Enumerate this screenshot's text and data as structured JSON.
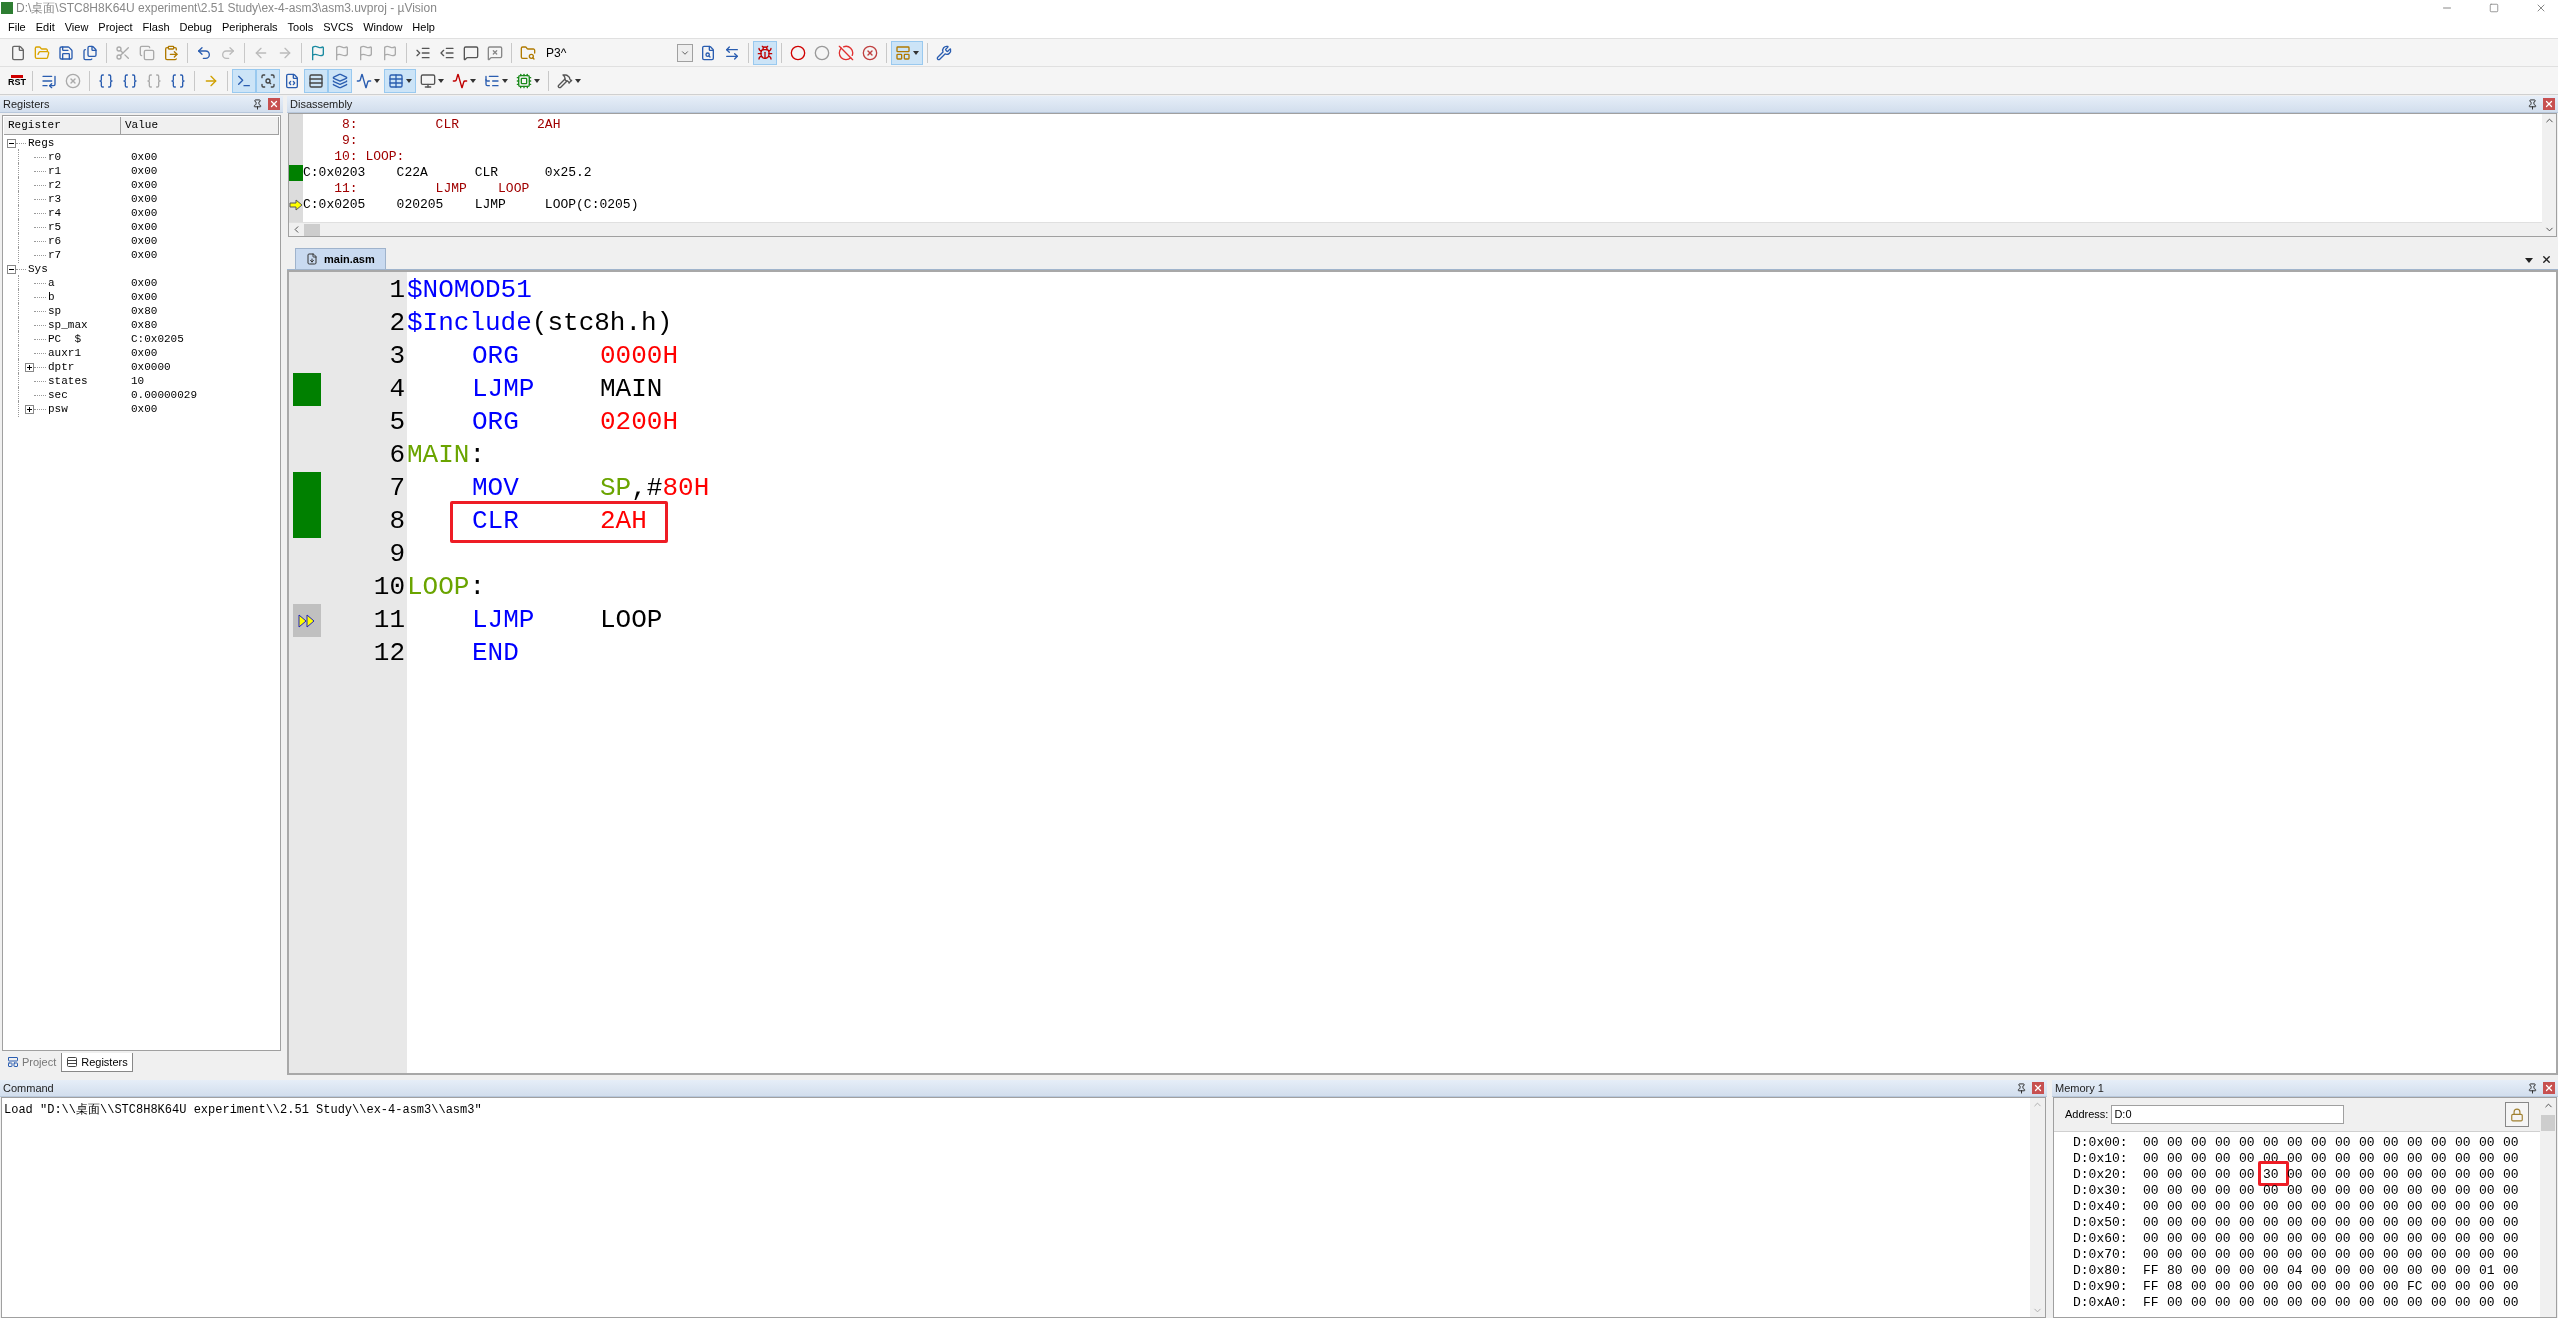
{
  "window": {
    "title": "D:\\桌面\\STC8H8K64U experiment\\2.51 Study\\ex-4-asm3\\asm3.uvproj - µVision"
  },
  "menu": [
    "File",
    "Edit",
    "View",
    "Project",
    "Flash",
    "Debug",
    "Peripherals",
    "Tools",
    "SVCS",
    "Window",
    "Help"
  ],
  "toolbar_1": {
    "items": [
      {
        "kind": "button",
        "pressed": false,
        "dropdown": false
      },
      {
        "kind": "button",
        "pressed": false,
        "dropdown": false
      },
      {
        "kind": "button",
        "pressed": false,
        "dropdown": false
      },
      {
        "kind": "button",
        "pressed": false,
        "dropdown": false
      },
      {
        "kind": "separator"
      },
      {
        "kind": "button",
        "pressed": false,
        "dropdown": false
      },
      {
        "kind": "button",
        "pressed": false,
        "dropdown": false
      },
      {
        "kind": "button",
        "pressed": false,
        "dropdown": false
      },
      {
        "kind": "separator"
      },
      {
        "kind": "button",
        "pressed": false,
        "dropdown": false
      },
      {
        "kind": "button",
        "pressed": false,
        "dropdown": false
      },
      {
        "kind": "separator"
      },
      {
        "kind": "button",
        "pressed": false,
        "dropdown": false
      },
      {
        "kind": "button",
        "pressed": false,
        "dropdown": false
      },
      {
        "kind": "separator"
      },
      {
        "kind": "button",
        "pressed": false,
        "dropdown": false
      },
      {
        "kind": "button",
        "pressed": false,
        "dropdown": false
      },
      {
        "kind": "button",
        "pressed": false,
        "dropdown": false
      },
      {
        "kind": "button",
        "pressed": false,
        "dropdown": false
      },
      {
        "kind": "separator"
      },
      {
        "kind": "button",
        "pressed": false,
        "dropdown": false
      },
      {
        "kind": "button",
        "pressed": false,
        "dropdown": false
      },
      {
        "kind": "button",
        "pressed": false,
        "dropdown": false
      },
      {
        "kind": "button",
        "pressed": false,
        "dropdown": false
      },
      {
        "kind": "separator"
      },
      {
        "kind": "button",
        "pressed": false,
        "dropdown": false
      },
      {
        "kind": "combo",
        "value": "P3^"
      },
      {
        "kind": "button",
        "pressed": false,
        "dropdown": false
      },
      {
        "kind": "button",
        "pressed": false,
        "dropdown": false
      },
      {
        "kind": "separator"
      },
      {
        "kind": "button",
        "pressed": true,
        "dropdown": false
      },
      {
        "kind": "separator"
      },
      {
        "kind": "button",
        "pressed": false,
        "dropdown": false
      },
      {
        "kind": "button",
        "pressed": false,
        "dropdown": false
      },
      {
        "kind": "button",
        "pressed": false,
        "dropdown": false
      },
      {
        "kind": "button",
        "pressed": false,
        "dropdown": false
      },
      {
        "kind": "separator"
      },
      {
        "kind": "button",
        "pressed": true,
        "dropdown": true
      },
      {
        "kind": "separator"
      },
      {
        "kind": "button",
        "pressed": false,
        "dropdown": false
      }
    ]
  },
  "toolbar_2": {
    "items": [
      {
        "kind": "text_button",
        "label": "RST"
      },
      {
        "kind": "separator"
      },
      {
        "kind": "button",
        "pressed": false,
        "dropdown": false
      },
      {
        "kind": "button",
        "pressed": false,
        "dropdown": false
      },
      {
        "kind": "separator"
      },
      {
        "kind": "button",
        "pressed": false,
        "dropdown": false
      },
      {
        "kind": "button",
        "pressed": false,
        "dropdown": false
      },
      {
        "kind": "button",
        "pressed": false,
        "dropdown": false
      },
      {
        "kind": "button",
        "pressed": false,
        "dropdown": false
      },
      {
        "kind": "separator"
      },
      {
        "kind": "button",
        "pressed": false,
        "dropdown": false
      },
      {
        "kind": "separator"
      },
      {
        "kind": "button",
        "pressed": true,
        "dropdown": false
      },
      {
        "kind": "button",
        "pressed": true,
        "dropdown": false
      },
      {
        "kind": "button",
        "pressed": false,
        "dropdown": false
      },
      {
        "kind": "button",
        "pressed": true,
        "dropdown": false
      },
      {
        "kind": "button",
        "pressed": true,
        "dropdown": false
      },
      {
        "kind": "button",
        "pressed": false,
        "dropdown": true
      },
      {
        "kind": "button",
        "pressed": true,
        "dropdown": true
      },
      {
        "kind": "button",
        "pressed": false,
        "dropdown": true
      },
      {
        "kind": "button",
        "pressed": false,
        "dropdown": true
      },
      {
        "kind": "button",
        "pressed": false,
        "dropdown": true
      },
      {
        "kind": "button",
        "pressed": false,
        "dropdown": true
      },
      {
        "kind": "separator"
      },
      {
        "kind": "button",
        "pressed": false,
        "dropdown": true
      }
    ]
  },
  "registers": {
    "title": "Registers",
    "columns": [
      "Register",
      "Value"
    ],
    "groups": [
      {
        "name": "Regs",
        "expanded": true,
        "children": [
          {
            "kind": "leaf",
            "name": "r0",
            "value": "0x00"
          },
          {
            "kind": "leaf",
            "name": "r1",
            "value": "0x00"
          },
          {
            "kind": "leaf",
            "name": "r2",
            "value": "0x00"
          },
          {
            "kind": "leaf",
            "name": "r3",
            "value": "0x00"
          },
          {
            "kind": "leaf",
            "name": "r4",
            "value": "0x00"
          },
          {
            "kind": "leaf",
            "name": "r5",
            "value": "0x00"
          },
          {
            "kind": "leaf",
            "name": "r6",
            "value": "0x00"
          },
          {
            "kind": "leaf",
            "name": "r7",
            "value": "0x00"
          }
        ]
      },
      {
        "name": "Sys",
        "expanded": true,
        "children": [
          {
            "kind": "leaf",
            "name": "a",
            "value": "0x00"
          },
          {
            "kind": "leaf",
            "name": "b",
            "value": "0x00"
          },
          {
            "kind": "leaf",
            "name": "sp",
            "value": "0x80"
          },
          {
            "kind": "leaf",
            "name": "sp_max",
            "value": "0x80"
          },
          {
            "kind": "leaf",
            "name": "PC  $",
            "value": "C:0x0205"
          },
          {
            "kind": "leaf",
            "name": "auxr1",
            "value": "0x00"
          },
          {
            "kind": "node",
            "expanded": false,
            "name": "dptr",
            "value": "0x0000"
          },
          {
            "kind": "leaf",
            "name": "states",
            "value": "10"
          },
          {
            "kind": "leaf",
            "name": "sec",
            "value": "0.00000029"
          },
          {
            "kind": "node",
            "expanded": false,
            "name": "psw",
            "value": "0x00"
          }
        ]
      }
    ],
    "tabs": [
      {
        "label": "Project",
        "selected": false
      },
      {
        "label": "Registers",
        "selected": true
      }
    ]
  },
  "disassembly": {
    "title": "Disassembly",
    "lines": [
      {
        "kind": "source",
        "executed": false,
        "current": false,
        "text": "     8:          CLR          2AH"
      },
      {
        "kind": "source",
        "executed": false,
        "current": false,
        "text": "     9:"
      },
      {
        "kind": "source",
        "executed": false,
        "current": false,
        "text": "    10: LOOP:"
      },
      {
        "kind": "asm",
        "executed": true,
        "current": false,
        "text": "C:0x0203    C22A      CLR      0x25.2"
      },
      {
        "kind": "source",
        "executed": false,
        "current": false,
        "text": "    11:          LJMP    LOOP"
      },
      {
        "kind": "asm",
        "executed": false,
        "current": true,
        "text": "C:0x0205    020205    LJMP     LOOP(C:0205)"
      }
    ]
  },
  "editor": {
    "tab": {
      "label": "main.asm",
      "selected": true
    },
    "lines": [
      {
        "number": "1",
        "kind": "directive",
        "executed": false,
        "current": false,
        "highlighted": false,
        "tokens": [
          {
            "kind": "keyword",
            "text": "$NOMOD51"
          }
        ]
      },
      {
        "number": "2",
        "kind": "directive",
        "executed": false,
        "current": false,
        "highlighted": false,
        "tokens": [
          {
            "kind": "keyword",
            "text": "$Include"
          },
          {
            "kind": "plain",
            "text": "(stc8h.h)"
          }
        ]
      },
      {
        "number": "3",
        "kind": "instruction",
        "executed": false,
        "current": false,
        "highlighted": false,
        "mnemonic": "ORG",
        "tokens": [
          {
            "kind": "number",
            "text": "0000H"
          }
        ]
      },
      {
        "number": "4",
        "kind": "instruction",
        "executed": true,
        "current": false,
        "highlighted": false,
        "mnemonic": "LJMP",
        "tokens": [
          {
            "kind": "plain",
            "text": "MAIN"
          }
        ]
      },
      {
        "number": "5",
        "kind": "instruction",
        "executed": false,
        "current": false,
        "highlighted": false,
        "mnemonic": "ORG",
        "tokens": [
          {
            "kind": "number",
            "text": "0200H"
          }
        ]
      },
      {
        "number": "6",
        "kind": "directive",
        "executed": false,
        "current": false,
        "highlighted": false,
        "tokens": [
          {
            "kind": "label",
            "text": "MAIN"
          },
          {
            "kind": "plain",
            "text": ":"
          }
        ]
      },
      {
        "number": "7",
        "kind": "instruction",
        "executed": true,
        "current": false,
        "highlighted": false,
        "mnemonic": "MOV",
        "tokens": [
          {
            "kind": "label",
            "text": "SP"
          },
          {
            "kind": "plain",
            "text": ",#"
          },
          {
            "kind": "number",
            "text": "80H"
          }
        ]
      },
      {
        "number": "8",
        "kind": "instruction",
        "executed": true,
        "current": false,
        "highlighted": true,
        "mnemonic": "CLR",
        "tokens": [
          {
            "kind": "number",
            "text": "2AH"
          }
        ]
      },
      {
        "number": "9",
        "kind": "blank",
        "executed": false,
        "current": false,
        "highlighted": false
      },
      {
        "number": "10",
        "kind": "directive",
        "executed": false,
        "current": false,
        "highlighted": false,
        "tokens": [
          {
            "kind": "label",
            "text": "LOOP"
          },
          {
            "kind": "plain",
            "text": ":"
          }
        ]
      },
      {
        "number": "11",
        "kind": "instruction",
        "executed": false,
        "current": true,
        "highlighted": false,
        "mnemonic": "LJMP",
        "tokens": [
          {
            "kind": "plain",
            "text": "LOOP"
          }
        ]
      },
      {
        "number": "12",
        "kind": "instruction",
        "executed": false,
        "current": false,
        "highlighted": false,
        "mnemonic": "END"
      }
    ]
  },
  "command": {
    "title": "Command",
    "output": "Load \"D:\\\\桌面\\\\STC8H8K64U experiment\\\\2.51 Study\\\\ex-4-asm3\\\\asm3\""
  },
  "memory": {
    "title": "Memory 1",
    "address_label": "Address:",
    "address": "D:0",
    "rows": [
      {
        "address": "D:0x00:",
        "values": [
          "00",
          "00",
          "00",
          "00",
          "00",
          "00",
          "00",
          "00",
          "00",
          "00",
          "00",
          "00",
          "00",
          "00",
          "00",
          "00"
        ],
        "highlighted": [
          false,
          false,
          false,
          false,
          false,
          false,
          false,
          false,
          false,
          false,
          false,
          false,
          false,
          false,
          false,
          false
        ]
      },
      {
        "address": "D:0x10:",
        "values": [
          "00",
          "00",
          "00",
          "00",
          "00",
          "00",
          "00",
          "00",
          "00",
          "00",
          "00",
          "00",
          "00",
          "00",
          "00",
          "00"
        ],
        "highlighted": [
          false,
          false,
          false,
          false,
          false,
          false,
          false,
          false,
          false,
          false,
          false,
          false,
          false,
          false,
          false,
          false
        ]
      },
      {
        "address": "D:0x20:",
        "values": [
          "00",
          "00",
          "00",
          "00",
          "00",
          "30",
          "00",
          "00",
          "00",
          "00",
          "00",
          "00",
          "00",
          "00",
          "00",
          "00"
        ],
        "highlighted": [
          false,
          false,
          false,
          false,
          false,
          true,
          false,
          false,
          false,
          false,
          false,
          false,
          false,
          false,
          false,
          false
        ]
      },
      {
        "address": "D:0x30:",
        "values": [
          "00",
          "00",
          "00",
          "00",
          "00",
          "00",
          "00",
          "00",
          "00",
          "00",
          "00",
          "00",
          "00",
          "00",
          "00",
          "00"
        ],
        "highlighted": [
          false,
          false,
          false,
          false,
          false,
          false,
          false,
          false,
          false,
          false,
          false,
          false,
          false,
          false,
          false,
          false
        ]
      },
      {
        "address": "D:0x40:",
        "values": [
          "00",
          "00",
          "00",
          "00",
          "00",
          "00",
          "00",
          "00",
          "00",
          "00",
          "00",
          "00",
          "00",
          "00",
          "00",
          "00"
        ],
        "highlighted": [
          false,
          false,
          false,
          false,
          false,
          false,
          false,
          false,
          false,
          false,
          false,
          false,
          false,
          false,
          false,
          false
        ]
      },
      {
        "address": "D:0x50:",
        "values": [
          "00",
          "00",
          "00",
          "00",
          "00",
          "00",
          "00",
          "00",
          "00",
          "00",
          "00",
          "00",
          "00",
          "00",
          "00",
          "00"
        ],
        "highlighted": [
          false,
          false,
          false,
          false,
          false,
          false,
          false,
          false,
          false,
          false,
          false,
          false,
          false,
          false,
          false,
          false
        ]
      },
      {
        "address": "D:0x60:",
        "values": [
          "00",
          "00",
          "00",
          "00",
          "00",
          "00",
          "00",
          "00",
          "00",
          "00",
          "00",
          "00",
          "00",
          "00",
          "00",
          "00"
        ],
        "highlighted": [
          false,
          false,
          false,
          false,
          false,
          false,
          false,
          false,
          false,
          false,
          false,
          false,
          false,
          false,
          false,
          false
        ]
      },
      {
        "address": "D:0x70:",
        "values": [
          "00",
          "00",
          "00",
          "00",
          "00",
          "00",
          "00",
          "00",
          "00",
          "00",
          "00",
          "00",
          "00",
          "00",
          "00",
          "00"
        ],
        "highlighted": [
          false,
          false,
          false,
          false,
          false,
          false,
          false,
          false,
          false,
          false,
          false,
          false,
          false,
          false,
          false,
          false
        ]
      },
      {
        "address": "D:0x80:",
        "values": [
          "FF",
          "80",
          "00",
          "00",
          "00",
          "00",
          "04",
          "00",
          "00",
          "00",
          "00",
          "00",
          "00",
          "00",
          "01",
          "00"
        ],
        "highlighted": [
          false,
          false,
          false,
          false,
          false,
          false,
          false,
          false,
          false,
          false,
          false,
          false,
          false,
          false,
          false,
          false
        ]
      },
      {
        "address": "D:0x90:",
        "values": [
          "FF",
          "08",
          "00",
          "00",
          "00",
          "00",
          "00",
          "00",
          "00",
          "00",
          "00",
          "FC",
          "00",
          "00",
          "00",
          "00"
        ],
        "highlighted": [
          false,
          false,
          false,
          false,
          false,
          false,
          false,
          false,
          false,
          false,
          false,
          false,
          false,
          false,
          false,
          false
        ]
      },
      {
        "address": "D:0xA0:",
        "values": [
          "FF",
          "00",
          "00",
          "00",
          "00",
          "00",
          "00",
          "00",
          "00",
          "00",
          "00",
          "00",
          "00",
          "00",
          "00",
          "00"
        ],
        "highlighted": [
          false,
          false,
          false,
          false,
          false,
          false,
          false,
          false,
          false,
          false,
          false,
          false,
          false,
          false,
          false,
          false
        ]
      }
    ]
  }
}
